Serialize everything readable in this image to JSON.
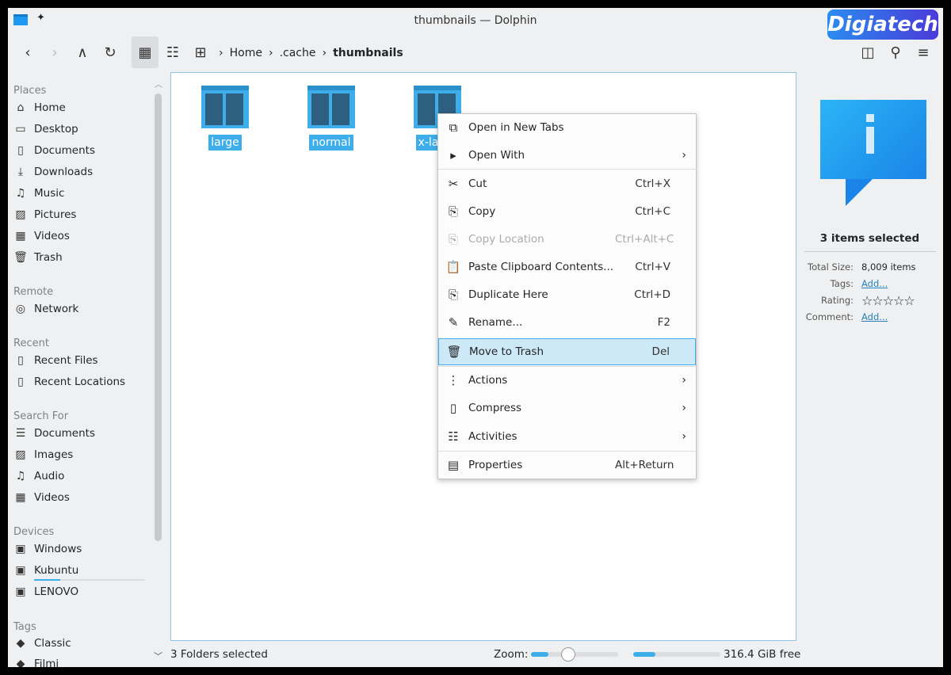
{
  "window": {
    "title": "thumbnails — Dolphin"
  },
  "watermark": "Digiatech",
  "toolbar": {
    "breadcrumb": [
      "Home",
      ".cache",
      "thumbnails"
    ]
  },
  "sidebar": {
    "sections": [
      {
        "header": "Places",
        "items": [
          {
            "label": "Home",
            "icon": "home-icon",
            "glyph": "⌂"
          },
          {
            "label": "Desktop",
            "icon": "desktop-icon",
            "glyph": "▭"
          },
          {
            "label": "Documents",
            "icon": "documents-icon",
            "glyph": "▯"
          },
          {
            "label": "Downloads",
            "icon": "downloads-icon",
            "glyph": "⤓"
          },
          {
            "label": "Music",
            "icon": "music-icon",
            "glyph": "♫"
          },
          {
            "label": "Pictures",
            "icon": "pictures-icon",
            "glyph": "▨"
          },
          {
            "label": "Videos",
            "icon": "videos-icon",
            "glyph": "▦"
          },
          {
            "label": "Trash",
            "icon": "trash-icon",
            "glyph": "🗑"
          }
        ]
      },
      {
        "header": "Remote",
        "items": [
          {
            "label": "Network",
            "icon": "network-icon",
            "glyph": "◎"
          }
        ]
      },
      {
        "header": "Recent",
        "items": [
          {
            "label": "Recent Files",
            "icon": "recent-files-icon",
            "glyph": "▯"
          },
          {
            "label": "Recent Locations",
            "icon": "recent-locations-icon",
            "glyph": "▯"
          }
        ]
      },
      {
        "header": "Search For",
        "items": [
          {
            "label": "Documents",
            "icon": "documents-icon",
            "glyph": "☰"
          },
          {
            "label": "Images",
            "icon": "images-icon",
            "glyph": "▨"
          },
          {
            "label": "Audio",
            "icon": "audio-icon",
            "glyph": "♫"
          },
          {
            "label": "Videos",
            "icon": "videos-icon",
            "glyph": "▦"
          }
        ]
      },
      {
        "header": "Devices",
        "items": [
          {
            "label": "Windows",
            "icon": "drive-icon",
            "glyph": "▣"
          },
          {
            "label": "Kubuntu",
            "icon": "drive-icon",
            "glyph": "▣"
          },
          {
            "label": "LENOVO",
            "icon": "drive-icon",
            "glyph": "▣"
          }
        ]
      },
      {
        "header": "Tags",
        "items": [
          {
            "label": "Classic",
            "icon": "tag-icon",
            "glyph": "◆"
          },
          {
            "label": "Filmi",
            "icon": "tag-icon",
            "glyph": "◆"
          }
        ]
      }
    ]
  },
  "folders": [
    "large",
    "normal",
    "x-large"
  ],
  "context_menu": {
    "items": [
      {
        "label": "Open in New Tabs",
        "icon": "new-tab-icon",
        "glyph": "⧉",
        "shortcut": ""
      },
      {
        "label": "Open With",
        "icon": "open-with-icon",
        "glyph": "▸",
        "shortcut": "",
        "submenu": true
      },
      {
        "label": "Cut",
        "icon": "cut-icon",
        "glyph": "✂",
        "shortcut": "Ctrl+X"
      },
      {
        "label": "Copy",
        "icon": "copy-icon",
        "glyph": "⎘",
        "shortcut": "Ctrl+C"
      },
      {
        "label": "Copy Location",
        "icon": "copy-location-icon",
        "glyph": "⎘",
        "shortcut": "Ctrl+Alt+C",
        "disabled": true
      },
      {
        "label": "Paste Clipboard Contents...",
        "icon": "paste-icon",
        "glyph": "📋",
        "shortcut": "Ctrl+V"
      },
      {
        "label": "Duplicate Here",
        "icon": "duplicate-icon",
        "glyph": "⎘",
        "shortcut": "Ctrl+D"
      },
      {
        "label": "Rename...",
        "icon": "rename-icon",
        "glyph": "✎",
        "shortcut": "F2"
      },
      {
        "label": "Move to Trash",
        "icon": "trash-icon",
        "glyph": "🗑",
        "shortcut": "Del",
        "highlighted": true
      },
      {
        "label": "Actions",
        "icon": "actions-icon",
        "glyph": "⋮",
        "shortcut": "",
        "submenu": true
      },
      {
        "label": "Compress",
        "icon": "compress-icon",
        "glyph": "▯",
        "shortcut": "",
        "submenu": true
      },
      {
        "label": "Activities",
        "icon": "activities-icon",
        "glyph": "☷",
        "shortcut": "",
        "submenu": true
      },
      {
        "label": "Properties",
        "icon": "properties-icon",
        "glyph": "▤",
        "shortcut": "Alt+Return"
      }
    ]
  },
  "info_panel": {
    "heading": "3 items selected",
    "total_size_label": "Total Size:",
    "total_size": "8,009 items",
    "tags_label": "Tags:",
    "tags_link": "Add...",
    "rating_label": "Rating:",
    "rating": 0,
    "rating_max": 5,
    "comment_label": "Comment:",
    "comment_link": "Add..."
  },
  "status": {
    "text": "3 Folders selected",
    "zoom_label": "Zoom:",
    "zoom_level": 0.2,
    "disk_used_fraction": 0.25,
    "free_space": "316.4 GiB free"
  },
  "colors": {
    "accent": "#3daee9",
    "highlight": "#cde8f6"
  }
}
